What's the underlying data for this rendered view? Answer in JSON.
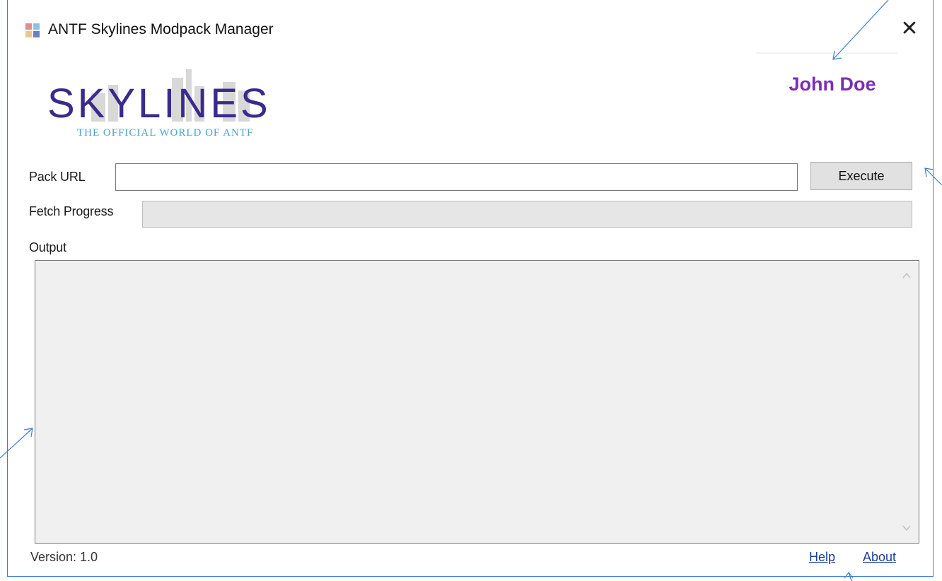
{
  "window": {
    "title": "ANTF Skylines Modpack Manager",
    "close_glyph": "✕"
  },
  "logo": {
    "wordmark": "SKYLINES",
    "tagline": "THE OFFICIAL WORLD OF ANTF",
    "wordmark_color": "#3b2a8c",
    "tagline_color": "#4aa3c6"
  },
  "user": {
    "name": "John Doe",
    "color": "#7a2fb5"
  },
  "form": {
    "pack_url_label": "Pack URL",
    "pack_url_value": "",
    "execute_label": "Execute",
    "fetch_progress_label": "Fetch Progress",
    "fetch_progress_value": 0,
    "output_label": "Output",
    "output_text": ""
  },
  "footer": {
    "version": "Version: 1.0",
    "help_label": "Help",
    "about_label": "About"
  },
  "icons": {
    "app": "app-icon",
    "close": "close-icon",
    "scroll_up": "scroll-up-icon",
    "scroll_down": "scroll-down-icon"
  },
  "accent_color": "#3c7fd6"
}
